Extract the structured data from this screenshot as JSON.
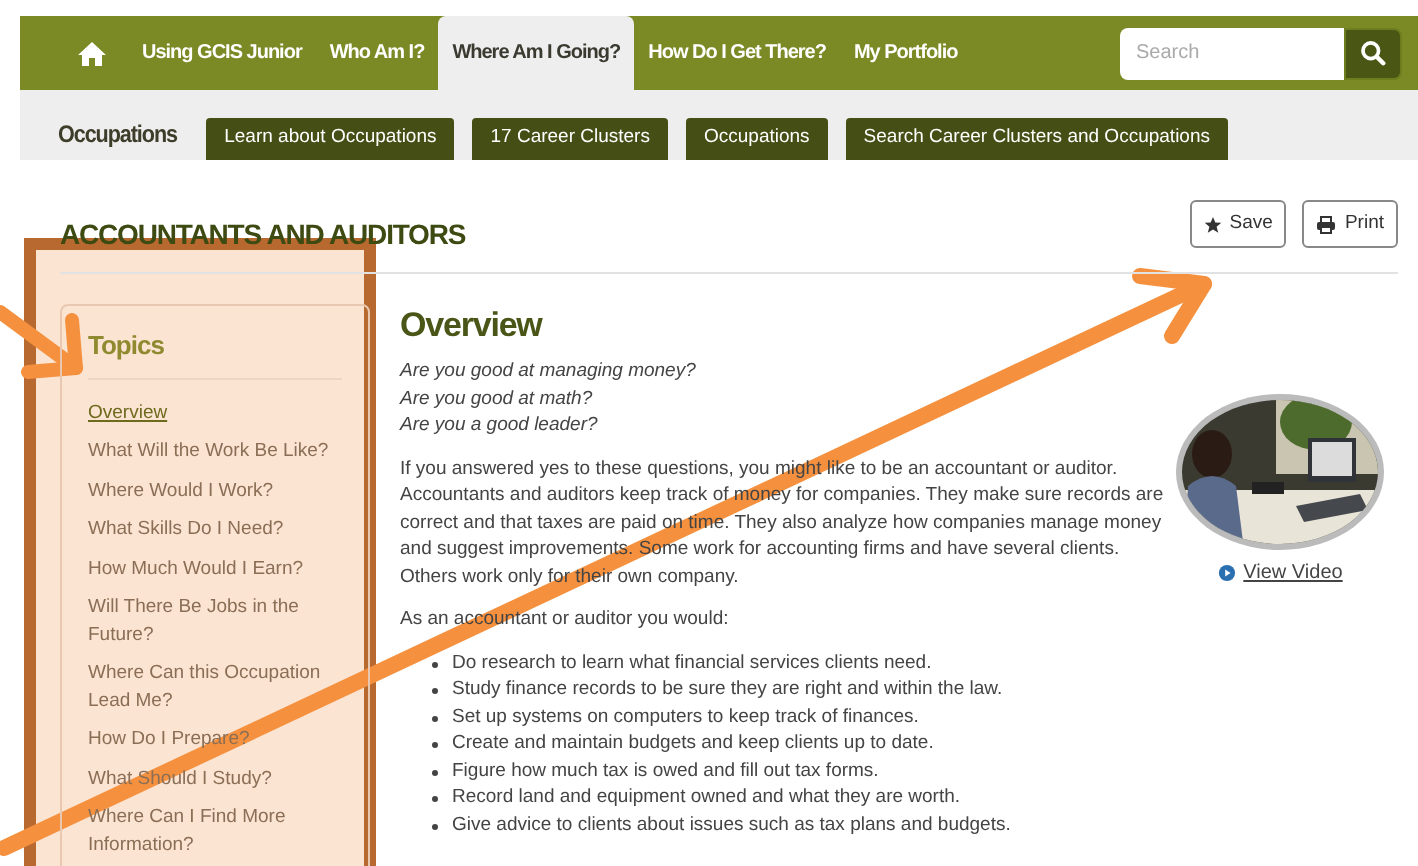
{
  "nav": {
    "items": [
      {
        "kind": "home",
        "selected": false
      },
      {
        "kind": "link",
        "label": "Using GCIS Junior",
        "selected": false
      },
      {
        "kind": "link",
        "label": "Who Am I?",
        "selected": false
      },
      {
        "kind": "link",
        "label": "Where Am I Going?",
        "selected": true
      },
      {
        "kind": "link",
        "label": "How Do I Get There?",
        "selected": false
      },
      {
        "kind": "link",
        "label": "My Portfolio",
        "selected": false
      }
    ],
    "search": {
      "placeholder": "Search"
    }
  },
  "subnav": {
    "label": "Occupations",
    "buttons": [
      "Learn about Occupations",
      "17 Career Clusters",
      "Occupations",
      "Search Career Clusters and Occupations"
    ]
  },
  "page": {
    "title": "ACCOUNTANTS AND AUDITORS",
    "actions": [
      {
        "kind": "star",
        "label": "Save"
      },
      {
        "kind": "print",
        "label": "Print"
      }
    ]
  },
  "topics": {
    "title": "Topics",
    "items": [
      {
        "label": "Overview",
        "selected": true
      },
      {
        "label": "What Will the Work Be Like?",
        "selected": false
      },
      {
        "label": "Where Would I Work?",
        "selected": false
      },
      {
        "label": "What Skills Do I Need?",
        "selected": false
      },
      {
        "label": "How Much Would I Earn?",
        "selected": false
      },
      {
        "label": "Will There Be Jobs in the Future?",
        "selected": false
      },
      {
        "label": "Where Can this Occupation Lead Me?",
        "selected": false
      },
      {
        "label": "How Do I Prepare?",
        "selected": false
      },
      {
        "label": "What Should I Study?",
        "selected": false
      },
      {
        "label": "Where Can I Find More Information?",
        "selected": false
      }
    ]
  },
  "content": {
    "heading": "Overview",
    "questions": [
      "Are you good at managing money?",
      "Are you good at math?",
      "Are you a good leader?"
    ],
    "paragraph": "If you answered yes to these questions, you might like to be an accountant or auditor. Accountants and auditors keep track of money for companies. They make sure records are correct and that taxes are paid on time. They also analyze how companies manage money and suggest improvements. Some work for accounting firms and have several clients. Others work only for their own company.",
    "lead": "As an accountant or auditor you would:",
    "bullets": [
      "Do research to learn what financial services clients need.",
      "Study finance records to be sure they are right and within the law.",
      "Set up systems on computers to keep track of finances.",
      "Create and maintain budgets and keep clients up to date.",
      "Figure how much tax is owed and fill out tax forms.",
      "Record land and equipment owned and what they are worth.",
      "Give advice to clients about issues such as tax plans and budgets."
    ],
    "video": {
      "kind": "picture",
      "link": "View Video"
    }
  }
}
